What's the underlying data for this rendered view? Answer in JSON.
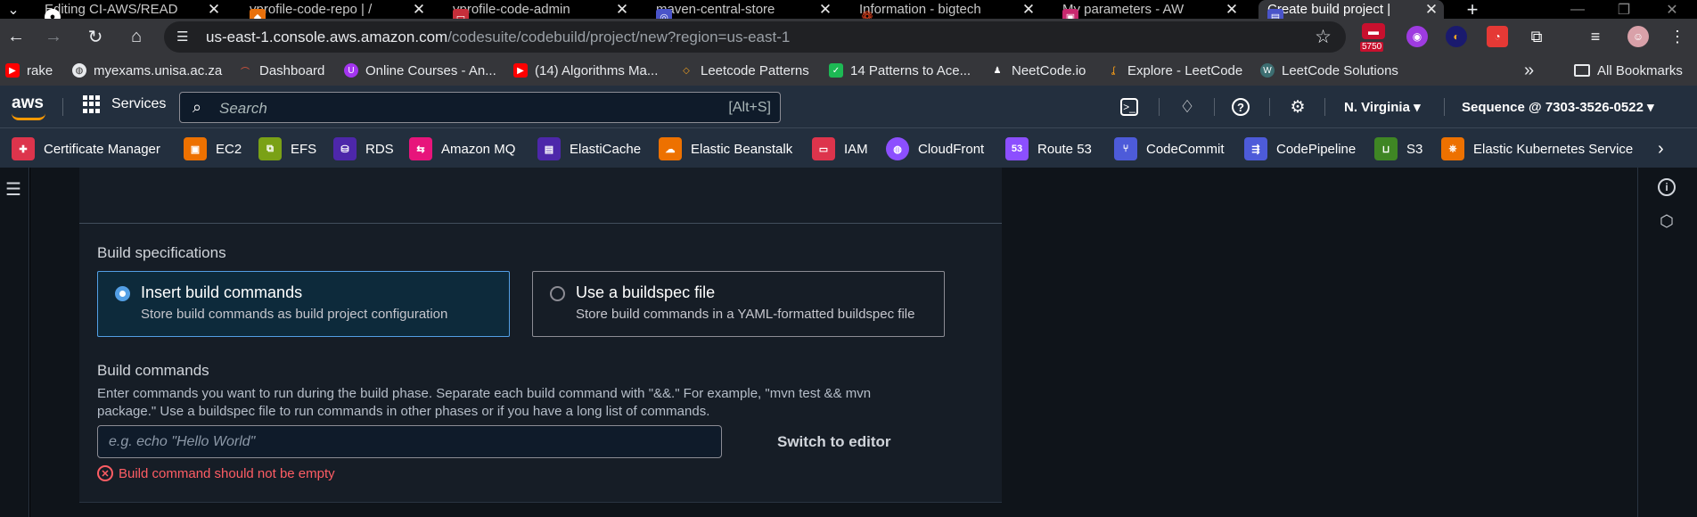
{
  "browser": {
    "tabs": [
      {
        "title": "Editing CI-AWS/READ",
        "icon": "github-icon",
        "color": "#24292e"
      },
      {
        "title": "vprofile-code-repo | /",
        "icon": "codecommit-cube-icon",
        "color": "#e8700b"
      },
      {
        "title": "vprofile-code-admin",
        "icon": "iam-icon",
        "color": "#c62e3a"
      },
      {
        "title": "maven-central-store",
        "icon": "codeartifact-icon",
        "color": "#4a54c9"
      },
      {
        "title": "Information - bigtech",
        "icon": "cluster-icon",
        "color": "#e1411d"
      },
      {
        "title": "My parameters - AW",
        "icon": "systems-manager-icon",
        "color": "#c7286e"
      },
      {
        "title": "Create build project |",
        "icon": "codebuild-icon",
        "color": "#4a54c9"
      }
    ],
    "new_tab": "+",
    "url_host": "us-east-1.console.aws.amazon.com",
    "url_path": "/codesuite/codebuild/project/new?region=us-east-1",
    "extension_badge": "5750",
    "bookmarks": [
      {
        "label": "rake",
        "icon": "youtube-icon"
      },
      {
        "label": "myexams.unisa.ac.za",
        "icon": "globe-icon"
      },
      {
        "label": "Dashboard",
        "icon": "dashboard-icon"
      },
      {
        "label": "Online Courses - An...",
        "icon": "udemy-icon"
      },
      {
        "label": "(14) Algorithms Ma...",
        "icon": "youtube-icon"
      },
      {
        "label": "Leetcode Patterns",
        "icon": "leetcode-patterns-icon"
      },
      {
        "label": "14 Patterns to Ace...",
        "icon": "patterns-icon"
      },
      {
        "label": "NeetCode.io",
        "icon": "neetcode-icon"
      },
      {
        "label": "Explore - LeetCode",
        "icon": "leetcode-icon"
      },
      {
        "label": "LeetCode Solutions",
        "icon": "walkccc-icon"
      }
    ],
    "bookmarks_more": "»",
    "all_bookmarks": "All Bookmarks"
  },
  "aws_nav": {
    "logo": "aws",
    "services_label": "Services",
    "search_placeholder": "Search",
    "search_shortcut": "[Alt+S]",
    "region": "N. Virginia",
    "account": "Sequence @ 7303-3526-0522"
  },
  "favorites": [
    {
      "label": "Certificate Manager",
      "color": "#dd344c"
    },
    {
      "label": "EC2",
      "color": "#ed7100"
    },
    {
      "label": "EFS",
      "color": "#7aa116"
    },
    {
      "label": "RDS",
      "color": "#4d27aa"
    },
    {
      "label": "Amazon MQ",
      "color": "#e7157b"
    },
    {
      "label": "ElastiCache",
      "color": "#4d27aa"
    },
    {
      "label": "Elastic Beanstalk",
      "color": "#ed7100"
    },
    {
      "label": "IAM",
      "color": "#dd344c"
    },
    {
      "label": "CloudFront",
      "color": "#8c4fff"
    },
    {
      "label": "Route 53",
      "color": "#8c4fff"
    },
    {
      "label": "CodeCommit",
      "color": "#4d5bd9"
    },
    {
      "label": "CodePipeline",
      "color": "#4d5bd9"
    },
    {
      "label": "S3",
      "color": "#3f8624"
    },
    {
      "label": "Elastic Kubernetes Service",
      "color": "#ed7100"
    }
  ],
  "form": {
    "build_spec_label": "Build specifications",
    "options": [
      {
        "title": "Insert build commands",
        "desc": "Store build commands as build project configuration",
        "selected": true
      },
      {
        "title": "Use a buildspec file",
        "desc": "Store build commands in a YAML-formatted buildspec file",
        "selected": false
      }
    ],
    "build_commands_label": "Build commands",
    "build_commands_help": "Enter commands you want to run during the build phase. Separate each build command with \"&&.\" For example, \"mvn test && mvn package.\" Use a buildspec file to run commands in other phases or if you have a long list of commands.",
    "build_commands_value": "",
    "build_commands_placeholder": "e.g. echo \"Hello World\"",
    "switch_editor": "Switch to editor",
    "error": "Build command should not be empty"
  },
  "colors": {
    "accent": "#0972d3",
    "error": "#ff5d64",
    "selected_border": "#539fe5"
  }
}
